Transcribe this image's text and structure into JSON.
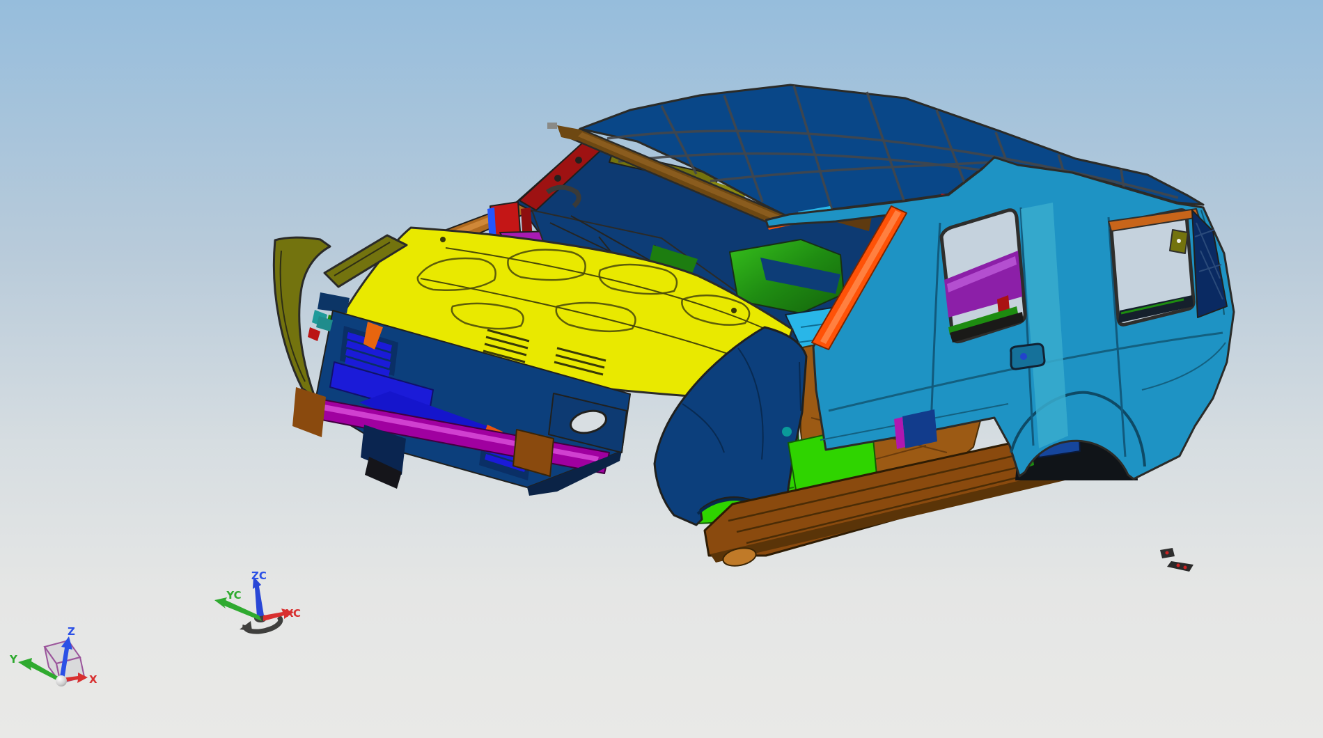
{
  "viewport": {
    "type": "cad-3d-view",
    "content": "multi-colored automotive body-in-white CAD model (SUV shell) in isometric view"
  },
  "axis_triads": {
    "wcs": {
      "z": "ZC",
      "y": "YC",
      "x": "XC"
    },
    "absolute": {
      "z": "Z",
      "y": "Y",
      "x": "X"
    }
  },
  "colors": {
    "bg_top": "#96bddc",
    "bg_upper": "#b9cbda",
    "bg_mid": "#d6dde1",
    "bg_lower": "#e5e6e5",
    "bg_bottom": "#e9e9e7",
    "roof_blue": "#094788",
    "roof_line": "#44464a",
    "body_cyan": "#1e93c4",
    "pillar_cyan": "#38abce",
    "window_bg": "#c5d2dd",
    "hood_yellow": "#e9e900",
    "hood_line": "#5e5e08",
    "fender_navy": "#0c3f7c",
    "interior_navy": "#0d3a72",
    "deep_navy": "#0a2a62",
    "header_brown": "#6e4812",
    "rocker_brown": "#8a4a0e",
    "rocker_face": "#5a3408",
    "floor_brown": "#9c5a14",
    "copper": "#b06a1e",
    "pillar_orange": "#ff5207",
    "accent_orange": "#e8650f",
    "maroon": "#9e1212",
    "red": "#c41616",
    "olive": "#73730e",
    "gold": "#b8860b",
    "grille_blue": "#1b1bd8",
    "bumper_magenta": "#a000a0",
    "cowl_magenta": "#a81bb4",
    "purple": "#8c1fa8",
    "dash_green": "#1f8c12",
    "bright_green": "#2fd400",
    "floor_cyan": "#29b6e8",
    "sill_cyan": "#00dcdc",
    "outline": "#2b2b28",
    "axis_blue": "#2b50e6",
    "axis_green": "#2faa2f",
    "axis_red": "#d83030",
    "wcs_dark": "#3f3f3d",
    "cube_purple": "#9b559b"
  }
}
